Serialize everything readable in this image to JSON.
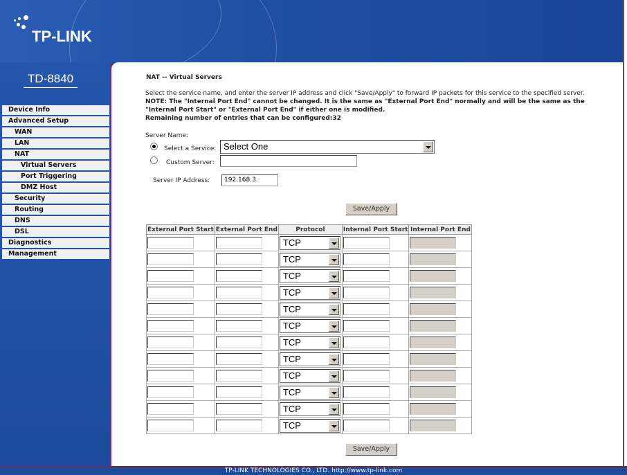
{
  "header": {
    "brand": "TP-LINK",
    "model": "TD-8840"
  },
  "sidebar": {
    "items": [
      {
        "label": "Device Info",
        "level": 1
      },
      {
        "label": "Advanced Setup",
        "level": 1
      },
      {
        "label": "WAN",
        "level": 2
      },
      {
        "label": "LAN",
        "level": 2
      },
      {
        "label": "NAT",
        "level": 2
      },
      {
        "label": "Virtual Servers",
        "level": 3
      },
      {
        "label": "Port Triggering",
        "level": 3
      },
      {
        "label": "DMZ Host",
        "level": 3
      },
      {
        "label": "Security",
        "level": 2
      },
      {
        "label": "Routing",
        "level": 2
      },
      {
        "label": "DNS",
        "level": 2
      },
      {
        "label": "DSL",
        "level": 2
      },
      {
        "label": "Diagnostics",
        "level": 1
      },
      {
        "label": "Management",
        "level": 1
      }
    ]
  },
  "main": {
    "title": "NAT -- Virtual Servers",
    "intro": "Select the service name, and enter the server IP address and click \"Save/Apply\" to forward IP packets for this service to the specified server.",
    "note1": "NOTE: The \"Internal Port End\" cannot be changed. It is the same as \"External Port End\" normally and will be the same as the",
    "note2": "\"Internal Port Start\" or \"External Port End\" if either one is modified.",
    "remaining": "Remaining number of entries that can be configured:32",
    "server_name_label": "Server Name:",
    "select_service_label": "Select a Service:",
    "select_service_value": "Select One",
    "custom_server_label": "Custom Server:",
    "custom_server_value": "",
    "server_ip_label": "Server IP Address:",
    "server_ip_value": "192.168.3.",
    "selected_radio": "select-service",
    "save_label": "Save/Apply",
    "table": {
      "columns": [
        "External Port Start",
        "External Port End",
        "Protocol",
        "Internal Port Start",
        "Internal Port End"
      ],
      "rows": [
        {
          "protocol": "TCP"
        },
        {
          "protocol": "TCP"
        },
        {
          "protocol": "TCP"
        },
        {
          "protocol": "TCP"
        },
        {
          "protocol": "TCP"
        },
        {
          "protocol": "TCP"
        },
        {
          "protocol": "TCP"
        },
        {
          "protocol": "TCP"
        },
        {
          "protocol": "TCP"
        },
        {
          "protocol": "TCP"
        },
        {
          "protocol": "TCP"
        },
        {
          "protocol": "TCP"
        }
      ]
    }
  },
  "footer": {
    "text": "TP-LINK TECHNOLOGIES CO., LTD. http://www.tp-link.com"
  }
}
